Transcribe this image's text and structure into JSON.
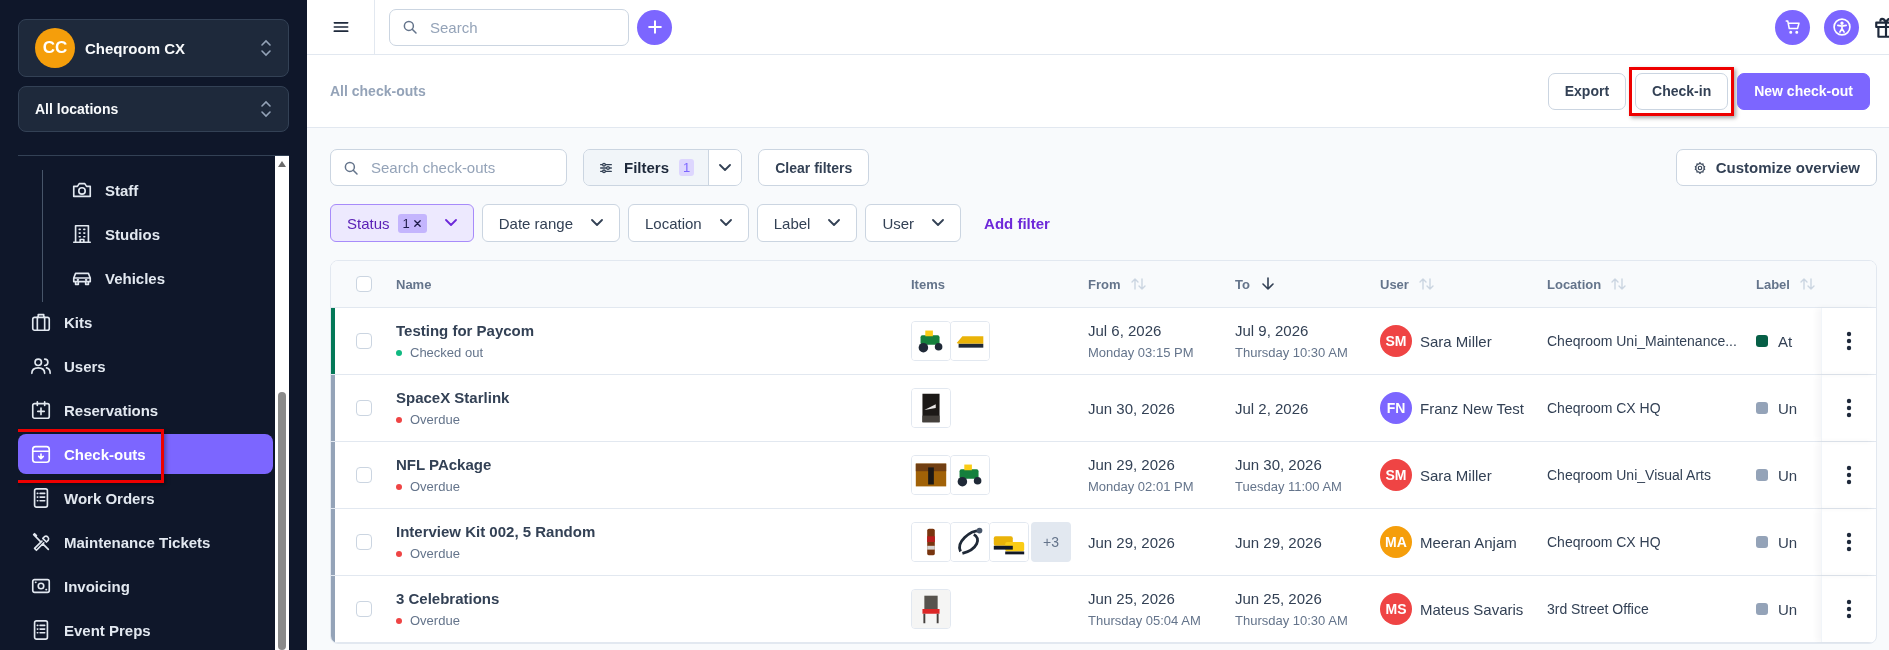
{
  "workspace": {
    "initials": "CC",
    "name": "Cheqroom CX"
  },
  "location_picker": {
    "value": "All locations"
  },
  "nav": [
    {
      "children": [
        {
          "label": "Staff",
          "selected": false,
          "highlighted": false
        },
        {
          "label": "Studios",
          "selected": false,
          "highlighted": false
        },
        {
          "label": "Vehicles",
          "selected": false,
          "highlighted": false
        }
      ]
    },
    {
      "label": "Kits",
      "selected": false,
      "highlighted": false
    },
    {
      "label": "Users",
      "selected": false,
      "highlighted": false
    },
    {
      "label": "Reservations",
      "selected": false,
      "highlighted": false
    },
    {
      "label": "Check-outs",
      "selected": true,
      "highlighted": true
    },
    {
      "label": "Work Orders",
      "selected": false,
      "highlighted": false
    },
    {
      "label": "Maintenance Tickets",
      "selected": false,
      "highlighted": false
    },
    {
      "label": "Invoicing",
      "selected": false,
      "highlighted": false
    },
    {
      "label": "Event Preps",
      "selected": false,
      "highlighted": false
    }
  ],
  "topbar": {
    "search": {
      "placeholder": "Search"
    }
  },
  "page": {
    "title": "All check-outs",
    "actions": [
      {
        "label": "Export",
        "kind": "secondary",
        "highlighted": false
      },
      {
        "label": "Check-in",
        "kind": "secondary",
        "highlighted": true
      },
      {
        "label": "New check-out",
        "kind": "primary",
        "highlighted": false
      }
    ]
  },
  "toolbar": {
    "search": {
      "placeholder": "Search check-outs"
    },
    "filters": {
      "label": "Filters",
      "count": "1"
    },
    "clear": "Clear filters",
    "customize": "Customize overview"
  },
  "filter_chips": [
    {
      "label": "Status",
      "count": "1",
      "active": true
    },
    {
      "label": "Date range",
      "active": false
    },
    {
      "label": "Location",
      "active": false
    },
    {
      "label": "Label",
      "active": false
    },
    {
      "label": "User",
      "active": false
    }
  ],
  "add_filter": "Add filter",
  "table": {
    "select_all": {
      "checked": false
    },
    "columns": [
      {
        "label": "Name"
      },
      {
        "label": "Items"
      },
      {
        "label": "From",
        "sorted": false
      },
      {
        "label": "To",
        "sorted": true
      },
      {
        "label": "User",
        "sorted": false
      },
      {
        "label": "Location",
        "sorted": false
      },
      {
        "label": "Label",
        "sorted": false
      }
    ],
    "rows": [
      {
        "name": "Testing for Paycom",
        "checked": false,
        "color": "#047857",
        "status": {
          "label": "Checked out",
          "color": "#10b981"
        },
        "from": {
          "date": "Jul 6, 2026",
          "detail": "Monday 03:15 PM"
        },
        "to": {
          "date": "Jul 9, 2026",
          "detail": "Thursday 10:30 AM"
        },
        "user": {
          "initials": "SM",
          "name": "Sara Miller",
          "color": "#ef4444"
        },
        "location": "Cheqroom Uni_Maintenance...",
        "label": {
          "text": "At",
          "color": "#065f46"
        }
      },
      {
        "name": "SpaceX Starlink",
        "checked": false,
        "color": "#94a3b8",
        "status": {
          "label": "Overdue",
          "color": "#ef4444"
        },
        "from": {
          "date": "Jun 30, 2026"
        },
        "to": {
          "date": "Jul 2, 2026"
        },
        "user": {
          "initials": "FN",
          "name": "Franz New Test",
          "color": "#7c66ff"
        },
        "location": "Cheqroom CX HQ",
        "label": {
          "text": "Un",
          "color": "#94a3b8"
        }
      },
      {
        "name": "NFL PAckage",
        "checked": false,
        "color": "#94a3b8",
        "status": {
          "label": "Overdue",
          "color": "#ef4444"
        },
        "from": {
          "date": "Jun 29, 2026",
          "detail": "Monday 02:01 PM"
        },
        "to": {
          "date": "Jun 30, 2026",
          "detail": "Tuesday 11:00 AM"
        },
        "user": {
          "initials": "SM",
          "name": "Sara Miller",
          "color": "#ef4444"
        },
        "location": "Cheqroom Uni_Visual Arts",
        "label": {
          "text": "Un",
          "color": "#94a3b8"
        }
      },
      {
        "name": "Interview Kit 002, 5 Random",
        "checked": false,
        "color": "#94a3b8",
        "status": {
          "label": "Overdue",
          "color": "#ef4444"
        },
        "more": "+3",
        "from": {
          "date": "Jun 29, 2026"
        },
        "to": {
          "date": "Jun 29, 2026"
        },
        "user": {
          "initials": "MA",
          "name": "Meeran Anjam",
          "color": "#f59e0b"
        },
        "location": "Cheqroom CX HQ",
        "label": {
          "text": "Un",
          "color": "#94a3b8"
        }
      },
      {
        "name": "3 Celebrations",
        "checked": false,
        "color": "#94a3b8",
        "status": {
          "label": "Overdue",
          "color": "#ef4444"
        },
        "from": {
          "date": "Jun 25, 2026",
          "detail": "Thursday 05:04 AM"
        },
        "to": {
          "date": "Jun 25, 2026",
          "detail": "Thursday 10:30 AM"
        },
        "user": {
          "initials": "MS",
          "name": "Mateus Savaris",
          "color": "#ef4444"
        },
        "location": "3rd Street Office",
        "label": {
          "text": "Un",
          "color": "#94a3b8"
        }
      }
    ]
  }
}
